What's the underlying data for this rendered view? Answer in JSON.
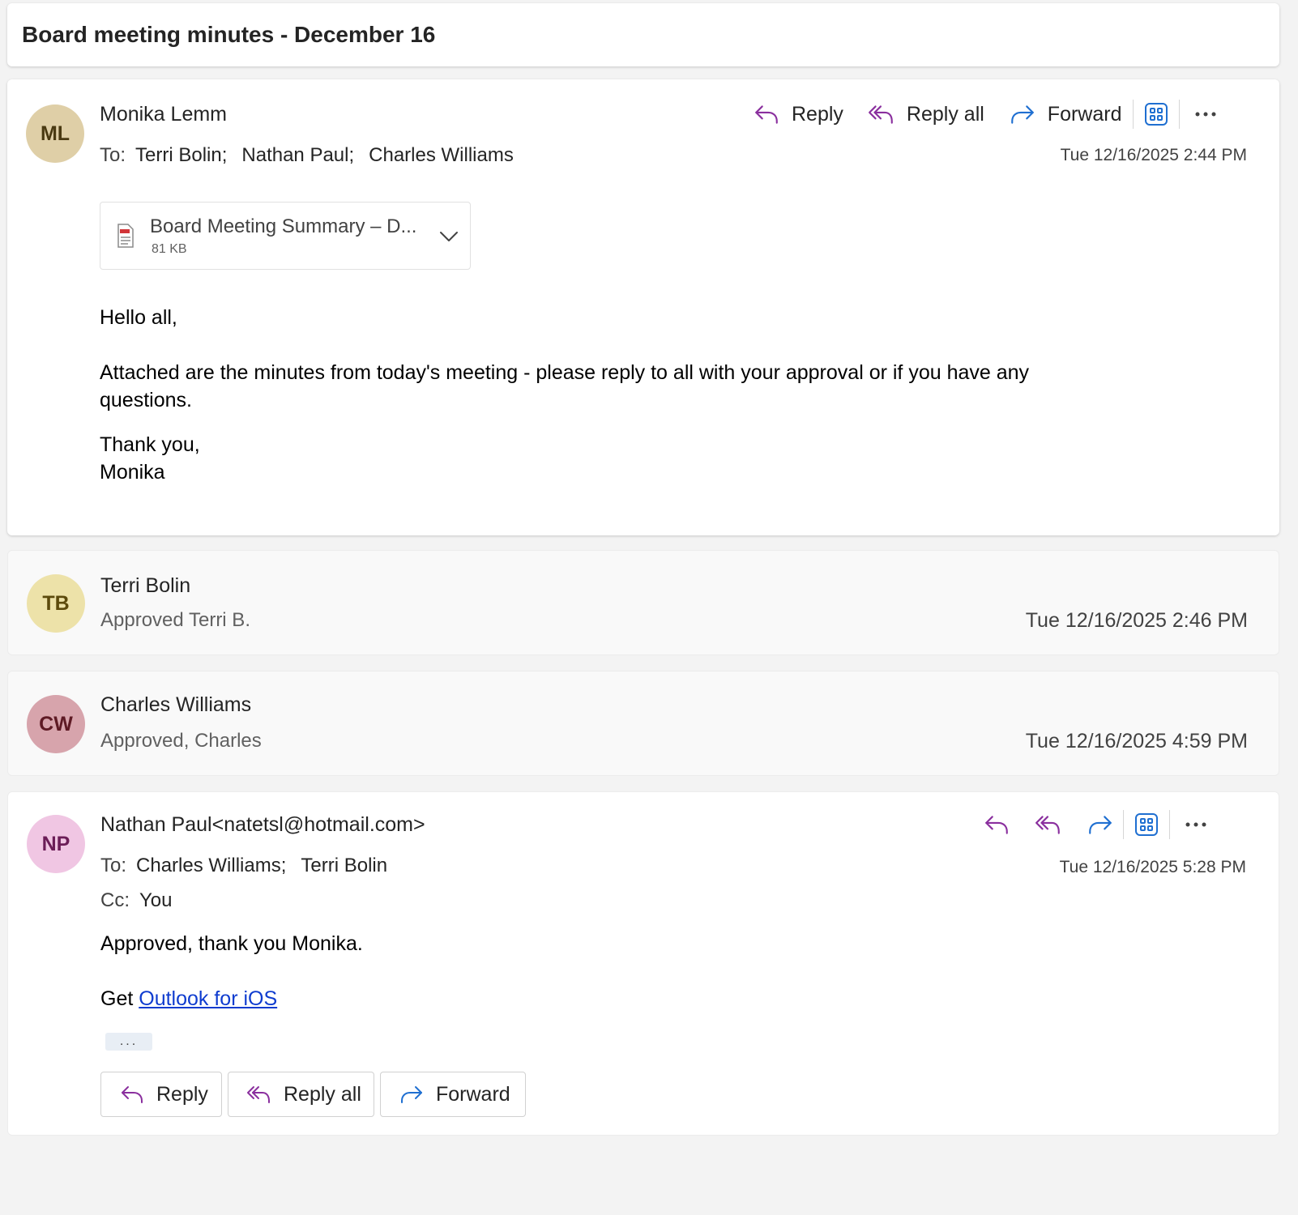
{
  "subject": "Board meeting minutes - December 16",
  "colors": {
    "reply_icon": "#8a2f9e",
    "forward_icon": "#1f6fd1",
    "link": "#0f3ccf"
  },
  "messages": [
    {
      "initials": "ML",
      "avatar_bg": "#dfcfa7",
      "avatar_fg": "#4a3a12",
      "sender": "Monika Lemm",
      "to_label": "To:",
      "to": [
        "Terri Bolin;",
        "Nathan Paul;",
        "Charles Williams"
      ],
      "date": "Tue 12/16/2025 2:44 PM",
      "actions": {
        "reply": "Reply",
        "reply_all": "Reply all",
        "forward": "Forward"
      },
      "attachment": {
        "name": "Board Meeting Summary – D...",
        "size": "81 KB"
      },
      "body": {
        "greeting": "Hello all,",
        "line1": "Attached are the minutes from today's meeting - please reply to all with your approval or if you have any",
        "line2": "questions.",
        "closing": "Thank you,",
        "signature": "Monika"
      }
    },
    {
      "initials": "TB",
      "avatar_bg": "#ede2a9",
      "avatar_fg": "#5c4a0c",
      "sender": "Terri Bolin",
      "preview": "Approved Terri B.",
      "date": "Tue 12/16/2025 2:46 PM"
    },
    {
      "initials": "CW",
      "avatar_bg": "#d7a4ac",
      "avatar_fg": "#5e1a24",
      "sender": "Charles Williams",
      "preview": "Approved, Charles",
      "date": "Tue 12/16/2025 4:59 PM"
    },
    {
      "initials": "NP",
      "avatar_bg": "#f0c6e3",
      "avatar_fg": "#6b1d57",
      "sender": "Nathan Paul<natetsl@hotmail.com>",
      "to_label": "To:",
      "to": [
        "Charles Williams;",
        "Terri Bolin"
      ],
      "cc_label": "Cc:",
      "cc": "You",
      "date": "Tue 12/16/2025 5:28 PM",
      "body": {
        "line1": "Approved, thank you Monika.",
        "get_prefix": "Get ",
        "link": "Outlook for iOS",
        "more": "..."
      },
      "bottom_actions": {
        "reply": "Reply",
        "reply_all": "Reply all",
        "forward": "Forward"
      }
    }
  ]
}
